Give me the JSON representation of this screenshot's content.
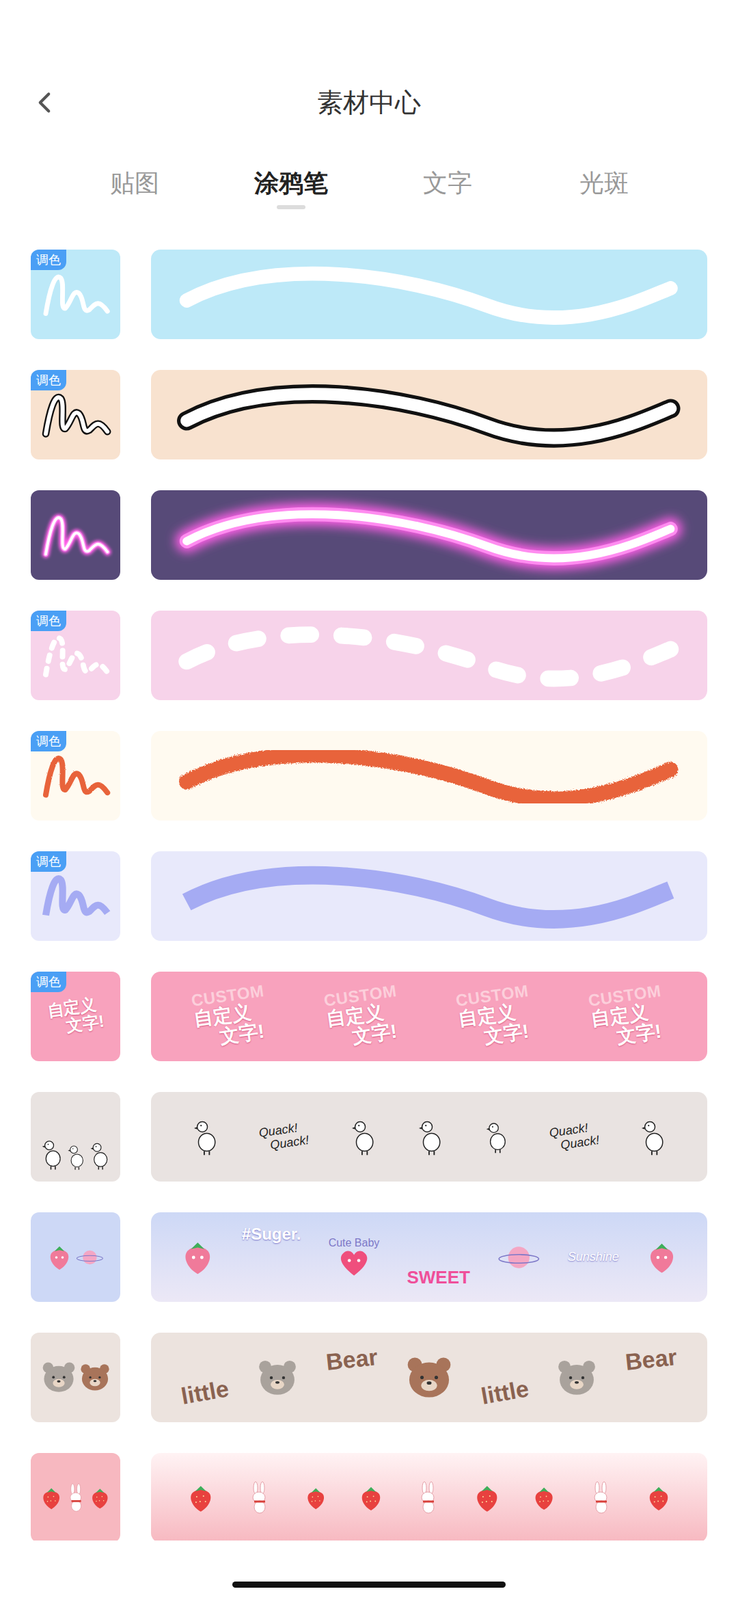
{
  "title": "素材中心",
  "tabs": [
    {
      "label": "贴图",
      "selected": false
    },
    {
      "label": "涂鸦笔",
      "selected": true
    },
    {
      "label": "文字",
      "selected": false
    },
    {
      "label": "光斑",
      "selected": false
    }
  ],
  "adjust_badge": "调色",
  "brushes": [
    {
      "kind": "line",
      "adjustable": true,
      "color": "#bde9f8",
      "texts": []
    },
    {
      "kind": "outline",
      "adjustable": true,
      "color": "#f8e2cf",
      "texts": []
    },
    {
      "kind": "neon",
      "adjustable": false,
      "color": "#574a78",
      "texts": []
    },
    {
      "kind": "dashed",
      "adjustable": true,
      "color": "#f7d3ea",
      "texts": []
    },
    {
      "kind": "crayon",
      "adjustable": true,
      "color": "#fffaf0",
      "texts": []
    },
    {
      "kind": "marker",
      "adjustable": true,
      "color": "#e8e9fb",
      "texts": []
    },
    {
      "kind": "custom",
      "adjustable": true,
      "color": "#f8a2bd",
      "texts": [
        "CUSTOM",
        "自定义",
        "文字!"
      ]
    },
    {
      "kind": "duck",
      "adjustable": false,
      "color": "#e9e3e1",
      "texts": [
        "Quack!",
        "Quack!"
      ]
    },
    {
      "kind": "sticker",
      "adjustable": false,
      "color": "#cdd8f6",
      "texts": [
        "#Suger.",
        "Cute Baby",
        "SWEET",
        "Sunshine"
      ]
    },
    {
      "kind": "bear",
      "adjustable": false,
      "color": "#ece3de",
      "texts": [
        "little",
        "Bear"
      ]
    },
    {
      "kind": "strawberry",
      "adjustable": false,
      "color": "#f7b8c0",
      "texts": []
    }
  ]
}
